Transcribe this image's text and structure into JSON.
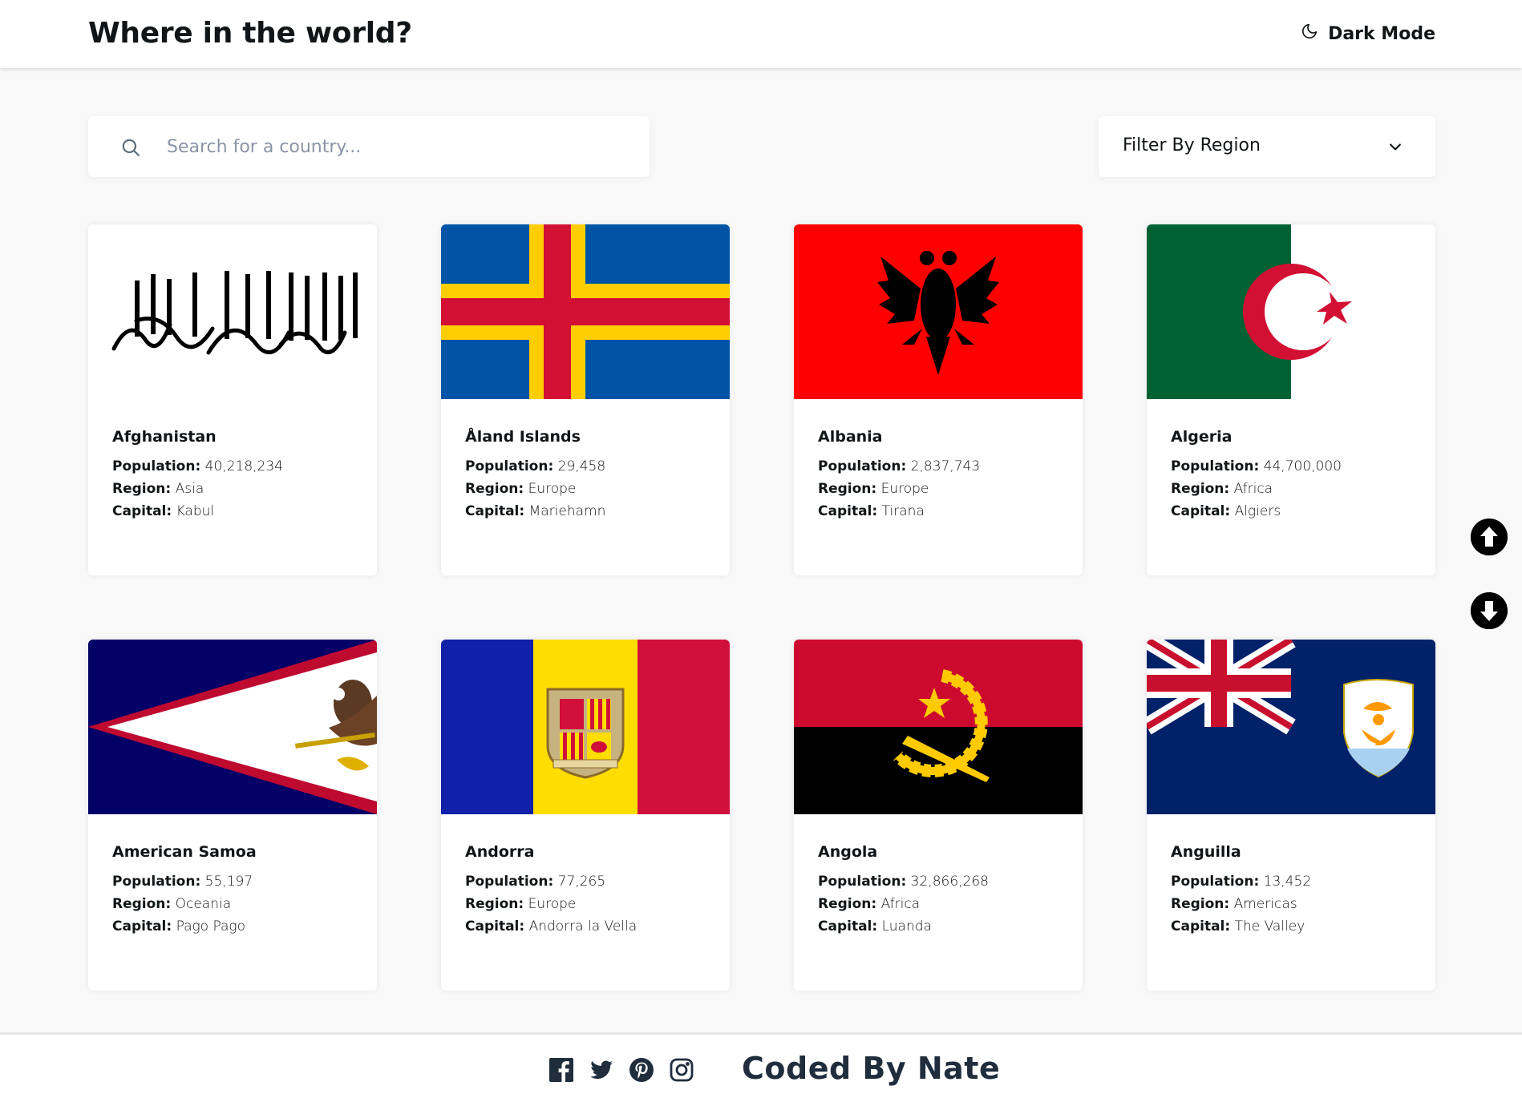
{
  "header": {
    "title": "Where in the world?",
    "theme_toggle_label": "Dark Mode",
    "theme_icon": "moon-icon"
  },
  "search": {
    "placeholder": "Search for a country...",
    "value": "",
    "icon": "search-icon"
  },
  "filter": {
    "label": "Filter By Region",
    "icon": "chevron-down-icon"
  },
  "labels": {
    "population": "Population:",
    "region": "Region:",
    "capital": "Capital:"
  },
  "countries": [
    {
      "name": "Afghanistan",
      "population": "40,218,234",
      "region": "Asia",
      "capital": "Kabul"
    },
    {
      "name": "Åland Islands",
      "population": "29,458",
      "region": "Europe",
      "capital": "Mariehamn"
    },
    {
      "name": "Albania",
      "population": "2,837,743",
      "region": "Europe",
      "capital": "Tirana"
    },
    {
      "name": "Algeria",
      "population": "44,700,000",
      "region": "Africa",
      "capital": "Algiers"
    },
    {
      "name": "American Samoa",
      "population": "55,197",
      "region": "Oceania",
      "capital": "Pago Pago"
    },
    {
      "name": "Andorra",
      "population": "77,265",
      "region": "Europe",
      "capital": "Andorra la Vella"
    },
    {
      "name": "Angola",
      "population": "32,866,268",
      "region": "Africa",
      "capital": "Luanda"
    },
    {
      "name": "Anguilla",
      "population": "13,452",
      "region": "Americas",
      "capital": "The Valley"
    }
  ],
  "scroll": {
    "up_icon": "arrow-up-circle-icon",
    "down_icon": "arrow-down-circle-icon"
  },
  "footer": {
    "social_icons": [
      "facebook-icon",
      "twitter-icon",
      "pinterest-icon",
      "instagram-icon"
    ],
    "credit": "Coded By Nate"
  }
}
